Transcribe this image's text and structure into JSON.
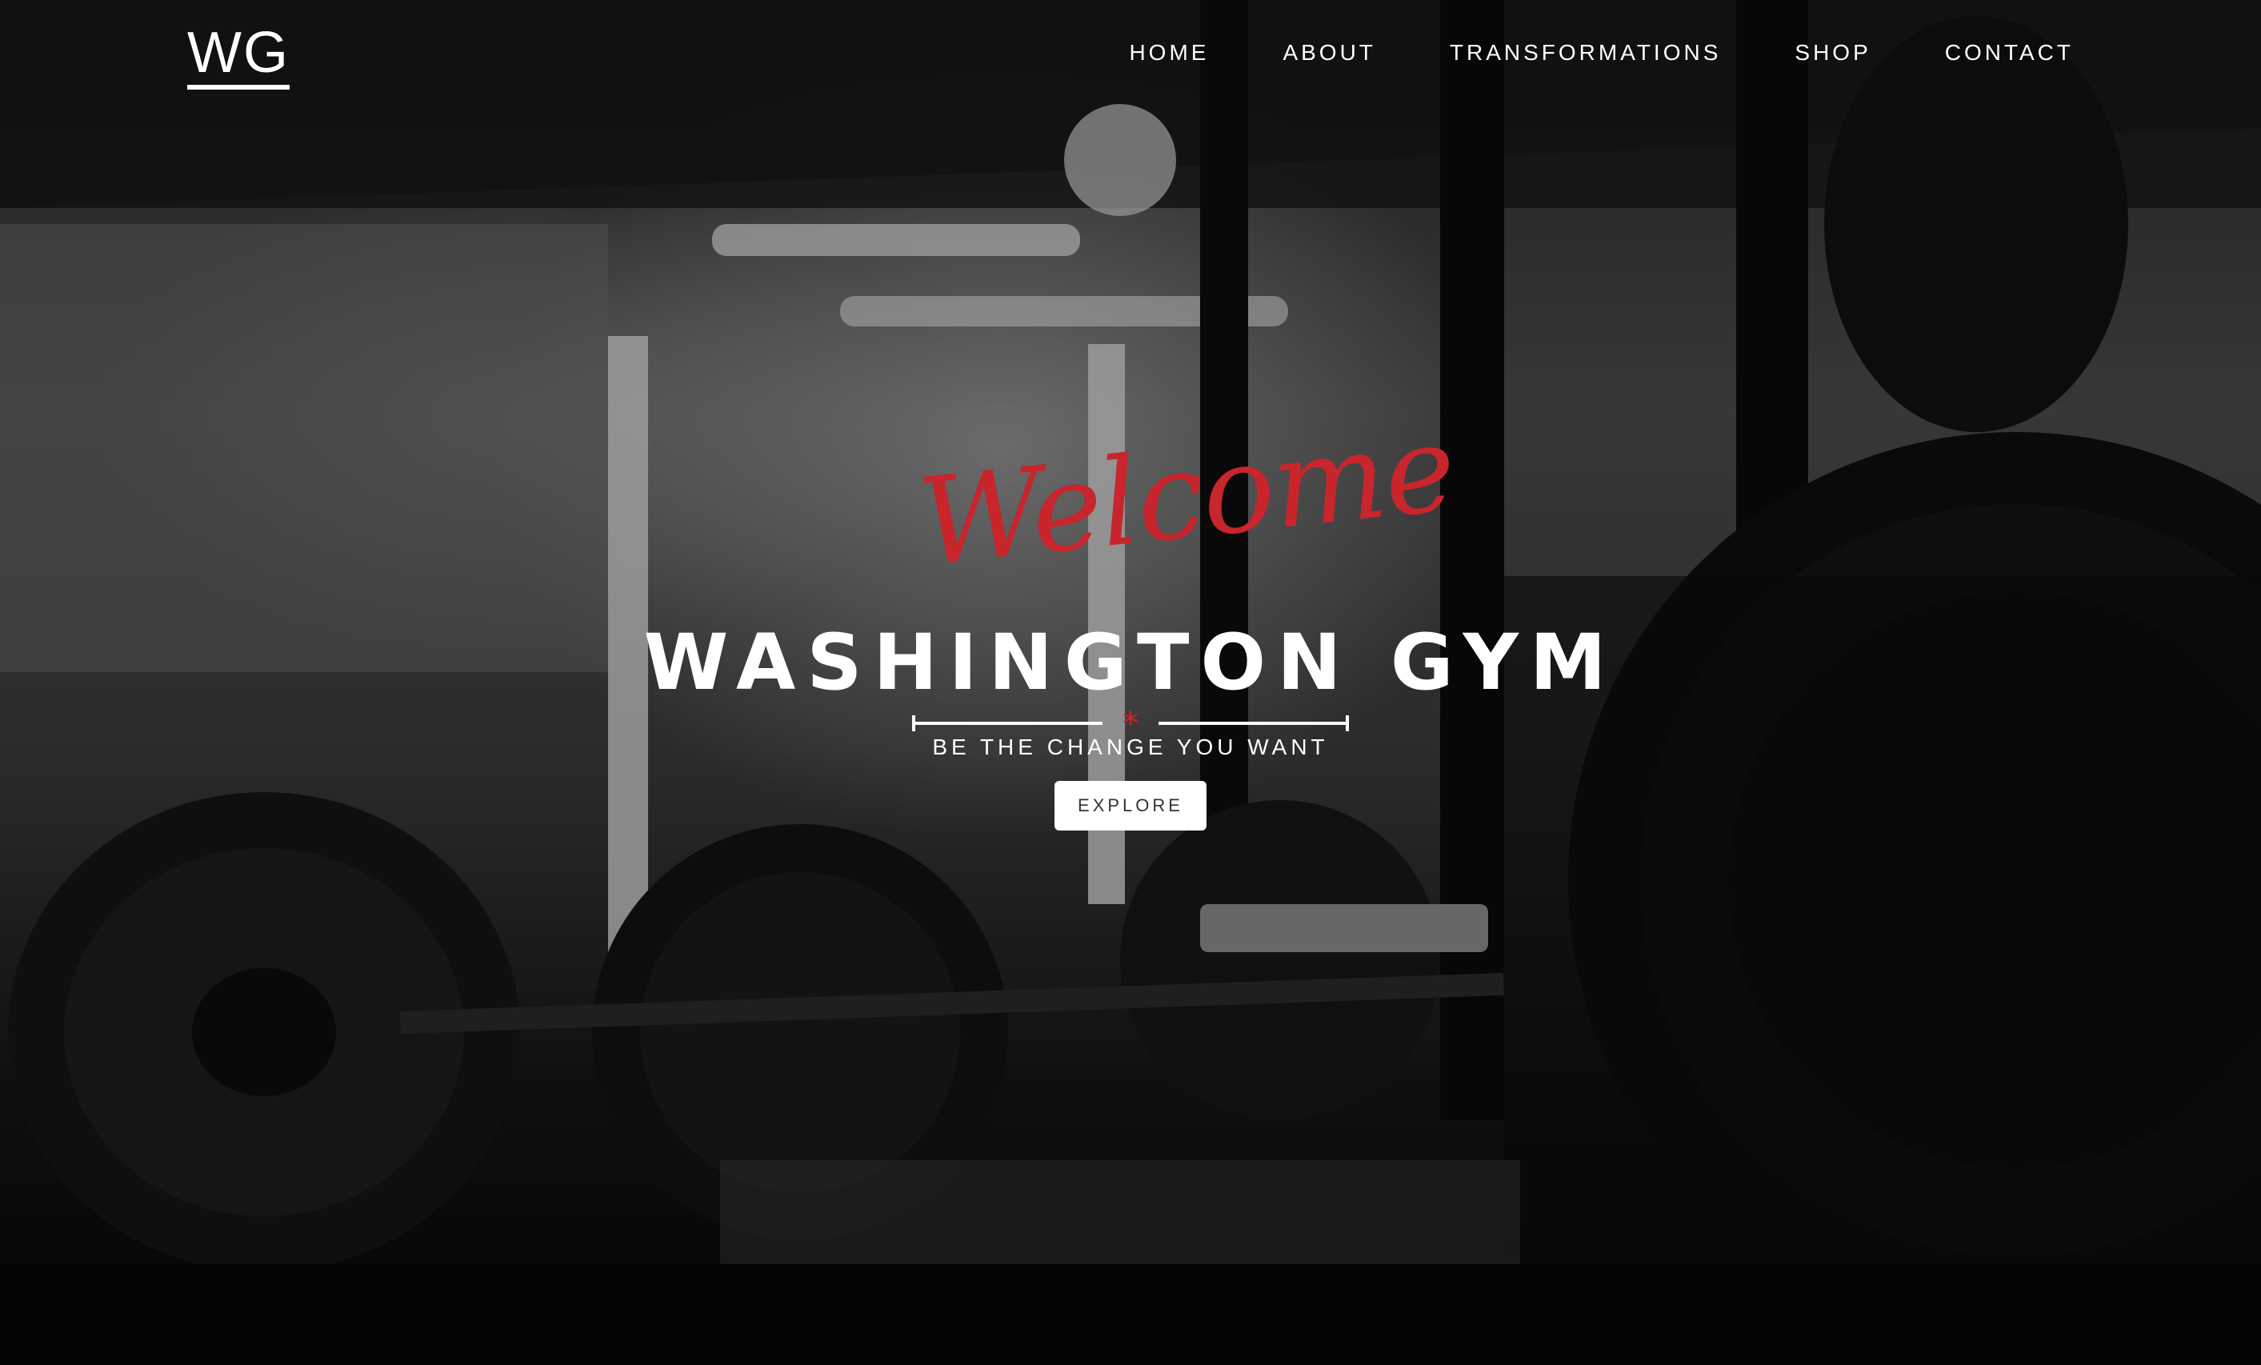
{
  "brand": {
    "logo": "WG"
  },
  "nav": {
    "items": [
      {
        "label": "HOME"
      },
      {
        "label": "ABOUT"
      },
      {
        "label": "TRANSFORMATIONS"
      },
      {
        "label": "SHOP"
      },
      {
        "label": "CONTACT"
      }
    ]
  },
  "hero": {
    "script_text": "Welcome",
    "title": "WASHINGTON GYM",
    "divider_mark": "*",
    "tagline": "BE THE CHANGE YOU WANT",
    "cta_label": "EXPLORE"
  },
  "colors": {
    "accent": "#c8252c",
    "text": "#ffffff",
    "button_bg": "#ffffff",
    "button_text": "#333333"
  }
}
